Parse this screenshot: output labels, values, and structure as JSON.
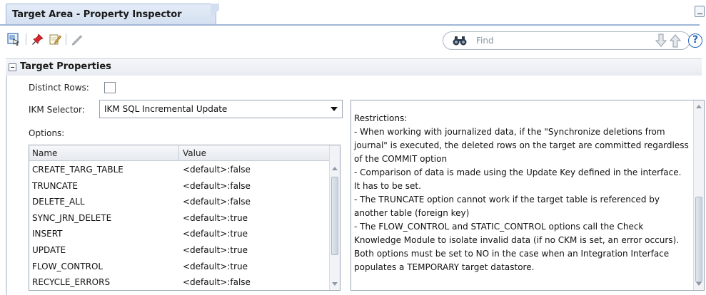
{
  "tab": {
    "title": "Target Area - Property Inspector"
  },
  "toolbar": {
    "icons": [
      "select-icon",
      "pin-icon",
      "edit-icon",
      "pencil-icon"
    ],
    "find_placeholder": "Find"
  },
  "section": {
    "title": "Target Properties"
  },
  "distinct_rows": {
    "label": "Distinct Rows:",
    "checked": false
  },
  "ikm_selector": {
    "label": "IKM Selector:",
    "value": "IKM SQL Incremental Update"
  },
  "options": {
    "label": "Options:",
    "columns": [
      "Name",
      "Value"
    ],
    "rows": [
      {
        "name": "CREATE_TARG_TABLE",
        "value": "<default>:false"
      },
      {
        "name": "TRUNCATE",
        "value": "<default>:false"
      },
      {
        "name": "DELETE_ALL",
        "value": "<default>:false"
      },
      {
        "name": "SYNC_JRN_DELETE",
        "value": "<default>:true"
      },
      {
        "name": "INSERT",
        "value": "<default>:true"
      },
      {
        "name": "UPDATE",
        "value": "<default>:true"
      },
      {
        "name": "FLOW_CONTROL",
        "value": "<default>:true"
      },
      {
        "name": "RECYCLE_ERRORS",
        "value": "<default>:false"
      }
    ]
  },
  "description": {
    "text": "Restrictions:\n- When working with journalized data, if the \"Synchronize deletions from journal\" is executed, the deleted rows on the target are committed regardless of the COMMIT option\n- Comparison of data is made using the Update Key defined in the interface. It has to be set.\n- The TRUNCATE option cannot work if the target table is referenced by another table (foreign key)\n- The FLOW_CONTROL and STATIC_CONTROL options call the Check Knowledge Module to isolate invalid data (if no CKM is set, an error occurs). Both options must be set to NO in the case when an Integration Interface populates a TEMPORARY target datastore."
  },
  "colors": {
    "accent": "#9fb6d6",
    "help": "#2a66b8"
  }
}
